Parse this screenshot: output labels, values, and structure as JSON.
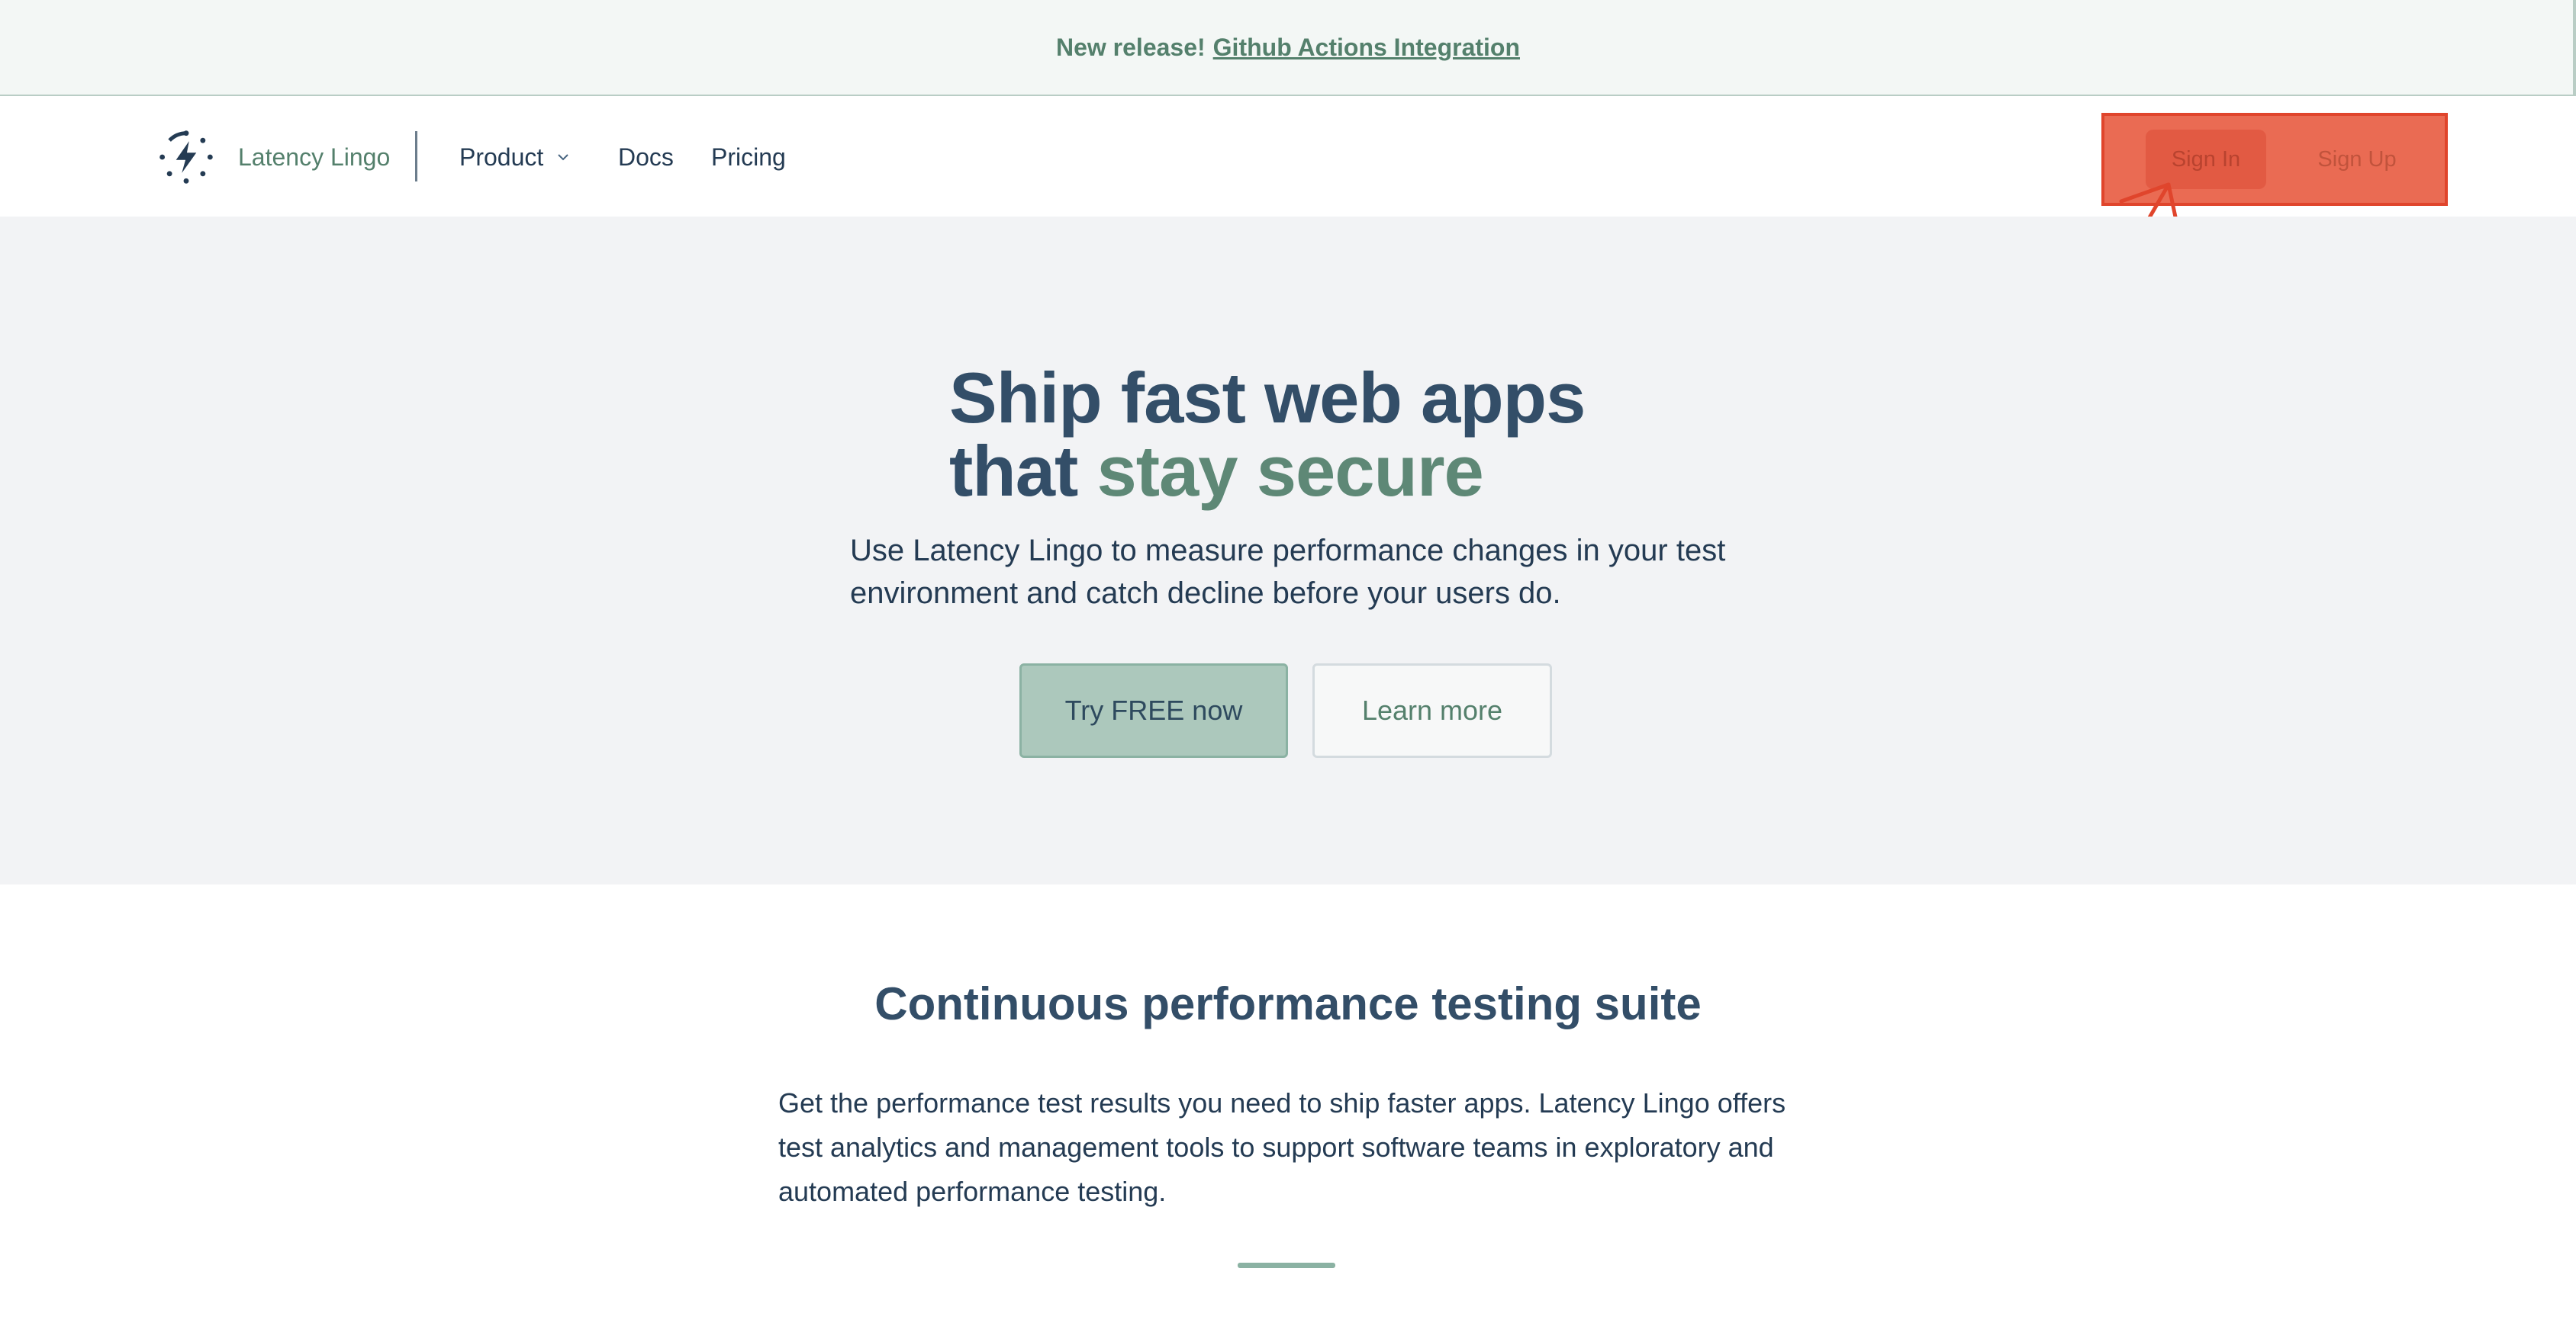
{
  "announcement": {
    "prefix": "New release!",
    "link": "Github Actions Integration"
  },
  "nav": {
    "brand": "Latency Lingo",
    "links": [
      {
        "label": "Product",
        "has_dropdown": true
      },
      {
        "label": "Docs"
      },
      {
        "label": "Pricing"
      }
    ],
    "sign_in": "Sign In",
    "sign_up": "Sign Up",
    "highlight_color": "#e0452c"
  },
  "hero": {
    "title_line1": "Ship fast web apps",
    "title_line2_prefix": "that",
    "title_line2_accent": "stay secure",
    "subtitle": "Use Latency Lingo to measure performance changes in your test environment and catch decline before your users do.",
    "primary_cta": "Try FREE now",
    "secondary_cta": "Learn more"
  },
  "features": {
    "title": "Continuous performance testing suite",
    "body": "Get the performance test results you need to ship faster apps. Latency Lingo offers test analytics and management tools to support software teams in exploratory and automated performance testing."
  },
  "colors": {
    "accent": "#5e8876",
    "heading": "#334e68",
    "annotation": "#e0452c"
  },
  "icons": [
    "logo-icon",
    "chevron-down-icon",
    "annotation-arrow-icon"
  ]
}
